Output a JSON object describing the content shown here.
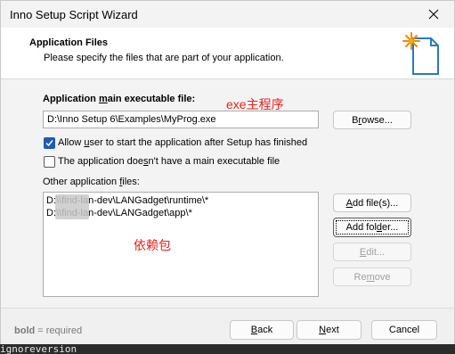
{
  "window": {
    "title": "Inno Setup Script Wizard"
  },
  "header": {
    "title": "Application Files",
    "subtitle": "Please specify the files that are part of your application."
  },
  "main_exe": {
    "label_pre": "Application ",
    "label_u": "m",
    "label_post": "ain executable file:",
    "value": "D:\\Inno Setup 6\\Examples\\MyProg.exe",
    "browse_label_pre": "B",
    "browse_label_u": "r",
    "browse_label_post": "owse..."
  },
  "annotations": {
    "main_program": "exe主程序",
    "dependencies": "依赖包"
  },
  "options": {
    "allow_user_checked": true,
    "allow_user_pre": "Allow ",
    "allow_user_u": "u",
    "allow_user_post": "ser to start the application after Setup has finished",
    "no_main_exe_checked": false,
    "no_main_exe_label_pre": "The application doe",
    "no_main_exe_label_u": "s",
    "no_main_exe_label_post": "n't have a main executable file"
  },
  "other_files": {
    "label_pre": "Other application ",
    "label_u": "f",
    "label_post": "iles:",
    "items": [
      "D:\\\\find-lan-dev\\LANGadget\\runtime\\*",
      "D:\\\\find-lan-dev\\LANGadget\\app\\*"
    ],
    "add_files_pre": "",
    "add_files_u": "A",
    "add_files_post": "dd file(s)...",
    "add_folder_pre": "Add fol",
    "add_folder_u": "d",
    "add_folder_post": "er...",
    "edit_pre": "",
    "edit_u": "E",
    "edit_post": "dit...",
    "remove_pre": "Re",
    "remove_u": "m",
    "remove_post": "ove"
  },
  "footer": {
    "note_bold": "bold",
    "note_rest": " = required",
    "back_pre": "",
    "back_u": "B",
    "back_post": "ack",
    "next_pre": "",
    "next_u": "N",
    "next_post": "ext",
    "cancel_label": "Cancel"
  },
  "background": {
    "text": "ignoreversion"
  },
  "colors": {
    "checkbox_accent": "#1e5bb4",
    "annotation_red": "#e8201c"
  }
}
